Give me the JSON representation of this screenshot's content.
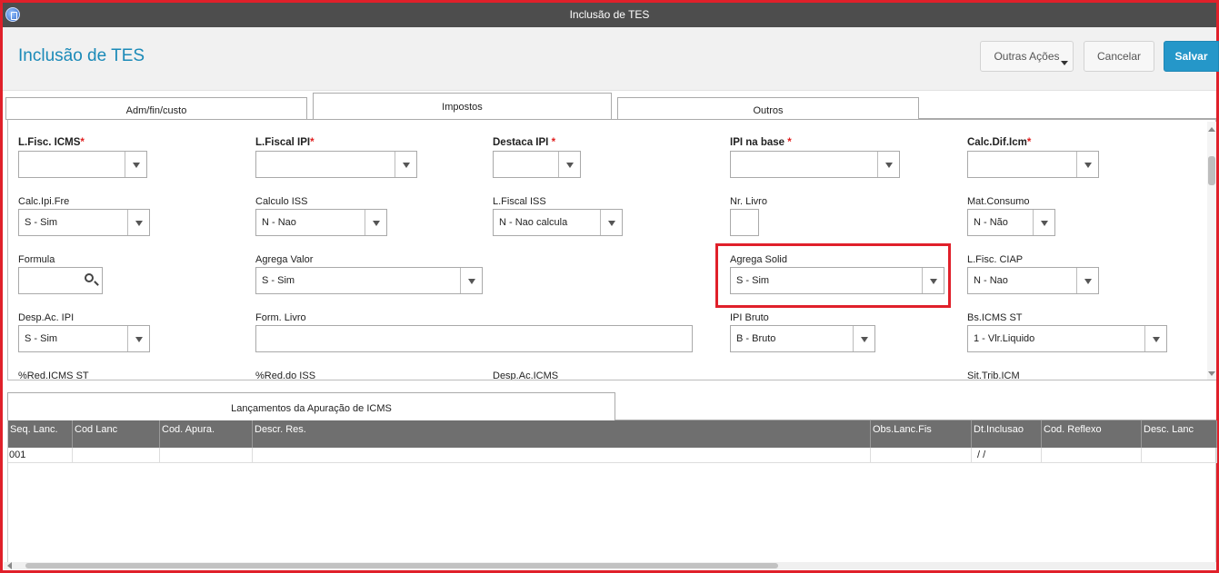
{
  "window": {
    "title": "Inclusão de TES"
  },
  "header": {
    "page_title": "Inclusão de TES",
    "buttons": {
      "outras": "Outras Ações",
      "cancelar": "Cancelar",
      "salvar": "Salvar"
    }
  },
  "tabs": [
    {
      "label": "Adm/fin/custo",
      "active": false
    },
    {
      "label": "Impostos",
      "active": true
    },
    {
      "label": "Outros",
      "active": false
    }
  ],
  "form": {
    "lfisc_icms": {
      "label": "L.Fisc. ICMS",
      "value": ""
    },
    "lfiscal_ipi": {
      "label": "L.Fiscal IPI",
      "value": ""
    },
    "destaca_ipi": {
      "label": "Destaca IPI",
      "value": ""
    },
    "ipi_na_base": {
      "label": "IPI na base",
      "value": ""
    },
    "calc_dif_icm": {
      "label": "Calc.Dif.Icm",
      "value": ""
    },
    "calc_ipi_fre": {
      "label": "Calc.Ipi.Fre",
      "value": "S - Sim"
    },
    "calculo_iss": {
      "label": "Calculo ISS",
      "value": "N - Nao"
    },
    "lfiscal_iss": {
      "label": "L.Fiscal ISS",
      "value": "N - Nao calcula"
    },
    "nr_livro": {
      "label": "Nr. Livro",
      "value": ""
    },
    "mat_consumo": {
      "label": "Mat.Consumo",
      "value": "N - Não"
    },
    "formula": {
      "label": "Formula",
      "value": ""
    },
    "agrega_valor": {
      "label": "Agrega Valor",
      "value": "S - Sim"
    },
    "agrega_solid": {
      "label": "Agrega Solid",
      "value": "S - Sim"
    },
    "lfisc_ciap": {
      "label": "L.Fisc. CIAP",
      "value": "N - Nao"
    },
    "desp_ac_ipi": {
      "label": "Desp.Ac. IPI",
      "value": "S - Sim"
    },
    "form_livro": {
      "label": "Form. Livro",
      "value": ""
    },
    "ipi_bruto": {
      "label": "IPI Bruto",
      "value": "B - Bruto"
    },
    "bs_icms_st": {
      "label": "Bs.ICMS ST",
      "value": "1 - Vlr.Liquido"
    },
    "red_icms_st": {
      "label": "%Red.ICMS ST"
    },
    "red_iss": {
      "label": "%Red.do ISS"
    },
    "desp_ac_icms": {
      "label": "Desp.Ac.ICMS"
    },
    "sit_trib_icm": {
      "label": "Sit.Trib.ICM"
    }
  },
  "bottom_tab": {
    "label": "Lançamentos da Apuração de ICMS"
  },
  "grid": {
    "columns": [
      "Seq. Lanc.",
      "Cod Lanc",
      "Cod. Apura.",
      "Descr. Res.",
      "Obs.Lanc.Fis",
      "Dt.Inclusao",
      "Cod. Reflexo",
      "Desc. Lanc"
    ],
    "rows": [
      [
        "001",
        "",
        "",
        "",
        "",
        " /  /",
        "",
        ""
      ]
    ]
  }
}
